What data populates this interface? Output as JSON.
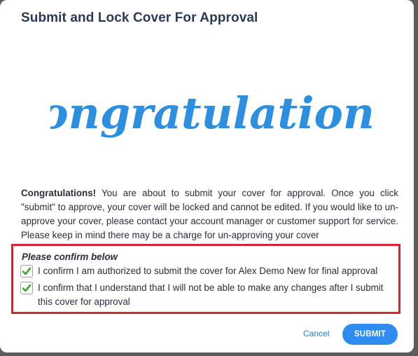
{
  "dialog": {
    "title": "Submit and Lock Cover For Approval",
    "hero_text": "Congratulations!"
  },
  "message": {
    "lead": "Congratulations!",
    "body": " You are about to submit your cover for approval. Once you click \"submit\" to approve, your cover will be locked and cannot be edited. If you would like to un-approve your cover, please contact your account manager or customer support for service. Please keep in mind there may be a charge for un-approving your cover"
  },
  "confirm": {
    "heading": "Please confirm below",
    "items": [
      {
        "label": "I confirm I am authorized to submit the cover for Alex Demo New for final approval",
        "checked": true
      },
      {
        "label": "I confirm that I understand that I will not be able to make any changes after I submit this cover for approval",
        "checked": true
      }
    ]
  },
  "actions": {
    "cancel_label": "Cancel",
    "submit_label": "SUBMIT"
  },
  "colors": {
    "accent": "#2f8cf0",
    "hero": "#2d8fe0",
    "highlight_border": "#d7262d",
    "check": "#3aa52a"
  }
}
